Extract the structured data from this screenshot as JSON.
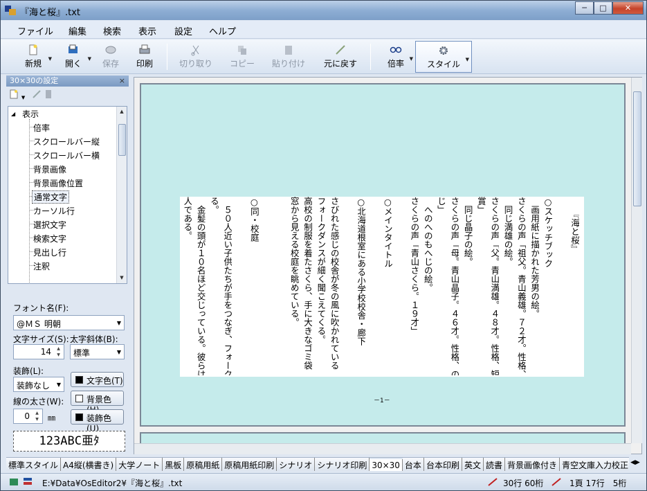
{
  "window": {
    "title": "『海と桜』.txt",
    "buttons": [
      "_",
      "□",
      "X"
    ]
  },
  "menu": [
    "ファイル",
    "編集",
    "検索",
    "表示",
    "設定",
    "ヘルプ"
  ],
  "toolbar": {
    "new": "新規",
    "open": "開く",
    "save": "保存",
    "print": "印刷",
    "cut": "切り取り",
    "copy": "コピー",
    "paste": "貼り付け",
    "undo": "元に戻す",
    "zoom": "倍率",
    "style": "スタイル"
  },
  "panel": {
    "title": "30×30の設定",
    "close": "×",
    "tree": {
      "root": "表示",
      "items": [
        "倍率",
        "スクロールバー縦",
        "スクロールバー横",
        "背景画像",
        "背景画像位置",
        "通常文字",
        "カーソル行",
        "選択文字",
        "検索文字",
        "見出し行",
        "注釈"
      ],
      "selected": "通常文字"
    },
    "font_label": "フォント名(F):",
    "font_value": "@ＭＳ 明朝",
    "size_label": "文字サイズ(S):",
    "size_value": "14",
    "bold_label": "太字斜体(B):",
    "bold_value": "標準",
    "deco_label": "装飾(L):",
    "deco_value": "装飾なし",
    "text_color_btn": "文字色(T)",
    "bg_color_btn": "背景色(H)",
    "deco_color_btn": "装飾色(U)",
    "line_width_label": "線の太さ(W):",
    "line_width_value": "0",
    "line_width_unit": "㎜",
    "preview": "123ABC亜ﾀ",
    "colors": {
      "text": "#000000",
      "bg": "#ffffff",
      "deco": "#000000"
    }
  },
  "document": {
    "columns": [
      "　　『海と桜』",
      "",
      "○スケッチブック",
      "　画用紙に描かれた芳男の絵。",
      "さくらの声「祖父。青山義雄。７２才。性格、温",
      "　同じ満雄の絵。",
      "さくらの声「父。青山満雄。４８才。性格、短気",
      "賞」",
      "　同じ晶子の絵。",
      "さくらの声「母。青山晶子。４６才。性格、のん",
      "じ」",
      "　へのへのもへじの絵。",
      "さくらの声「青山さくら。１９才」",
      "",
      "○メインタイトル",
      "",
      "○北海道根室にある小学校校舎・廊下",
      "",
      "さびれた感じの校舎が冬の風に吹かれている",
      "フォークダンスが細く聞こえてくる。",
      "高校の制服を着たさくら、手に大きなゴミ袋",
      "窓から見える校庭を眺めている。",
      "",
      "",
      "○同・校庭",
      "",
      "　５０人近い子供たちが手をつなぎ、フォーク",
      "る。",
      "　金髪の頭が１０名ほど交じっている。彼らは",
      "人である。"
    ],
    "page_number": "－1－"
  },
  "tabs": [
    "標準スタイル",
    "A4縦(横書き)",
    "大学ノート",
    "黒板",
    "原稿用紙",
    "原稿用紙印刷",
    "シナリオ",
    "シナリオ印刷",
    "30×30",
    "台本",
    "台本印刷",
    "英文",
    "読書",
    "背景画像付き",
    "青空文庫入力校正"
  ],
  "active_tab": "30×30",
  "status": {
    "path": "E:¥Data¥OsEditor2¥『海と桜』.txt",
    "grid": "30行 60桁",
    "position": "1頁 17行　5桁"
  }
}
